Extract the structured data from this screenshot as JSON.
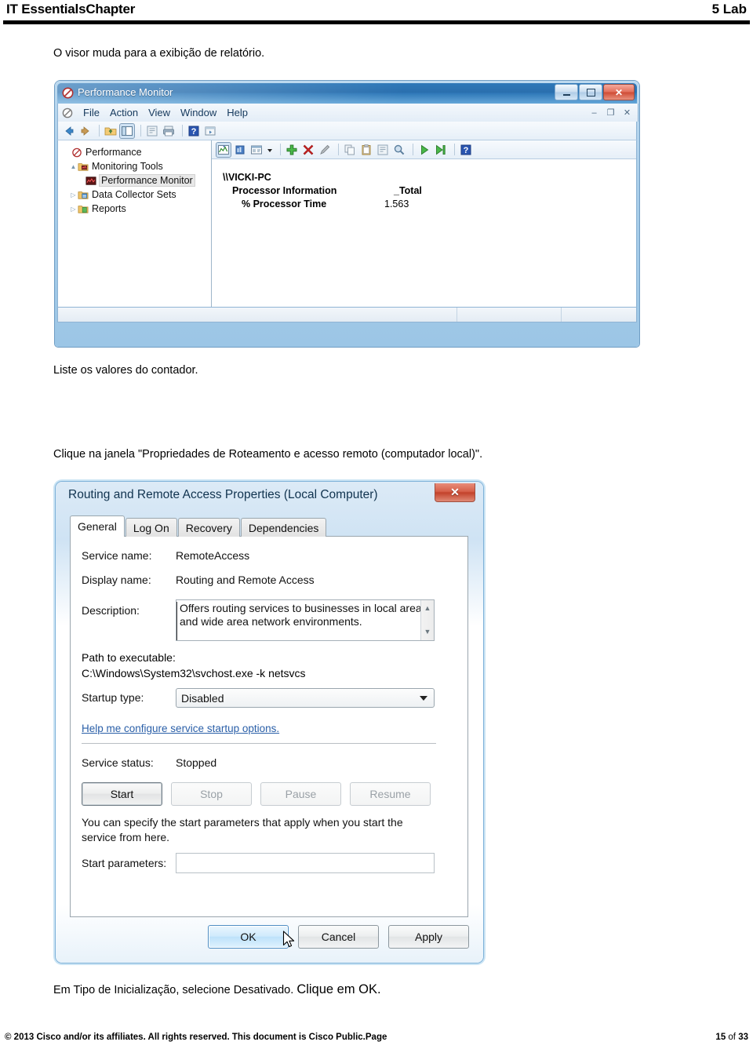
{
  "page_header": {
    "left_title": "IT EssentialsChapter",
    "right_title": "5 Lab"
  },
  "paragraphs": {
    "p1": "O visor muda para a exibição de relatório.",
    "p2": "Liste os valores do contador.",
    "p3": "Clique na janela \"Propriedades de Roteamento e acesso remoto (computador local)\".",
    "p4_a": "Em Tipo de Inicialização, selecione Desativado. ",
    "p4_b": "Clique em OK."
  },
  "page_footer": {
    "copyright": "© 2013 Cisco and/or its affiliates. All rights reserved. This document is Cisco Public.Page",
    "page_num": "15",
    "page_of": " of ",
    "page_total": "33"
  },
  "perfmon": {
    "title": "Performance Monitor",
    "icon": "performance-monitor-icon",
    "window_buttons": {
      "minimize": "minimize-icon",
      "maximize": "maximize-icon",
      "close": "✕"
    },
    "mdi_buttons": {
      "minimize": "–",
      "restore": "❐",
      "close": "✕"
    },
    "menu": [
      "File",
      "Action",
      "View",
      "Window",
      "Help"
    ],
    "toolbar_icons": [
      "back-arrow-icon",
      "forward-arrow-icon",
      "sep",
      "up-folder-icon",
      "show-hide-console-tree-icon",
      "sep",
      "properties-icon",
      "print-icon",
      "sep",
      "help-icon",
      "new-window-icon"
    ],
    "report_toolbar_icons": [
      "view-graph-icon",
      "view-histogram-icon",
      "view-report-icon",
      "view-dropdown-caret",
      "sep",
      "add-counter-icon",
      "delete-counter-icon",
      "highlight-icon",
      "sep",
      "copy-properties-icon",
      "paste-counter-list-icon",
      "properties-icon",
      "zoom-icon",
      "sep",
      "unfreeze-display-icon",
      "update-data-icon",
      "sep",
      "help-icon"
    ],
    "tree": [
      {
        "label": "Performance",
        "icon": "performance-root-icon",
        "depth": 0,
        "arrow": "",
        "selected": false
      },
      {
        "label": "Monitoring Tools",
        "icon": "monitoring-tools-folder-icon",
        "depth": 1,
        "arrow": "▲",
        "selected": false
      },
      {
        "label": "Performance Monitor",
        "icon": "performance-monitor-small-icon",
        "depth": 2,
        "arrow": "",
        "selected": true
      },
      {
        "label": "Data Collector Sets",
        "icon": "data-collector-sets-icon",
        "depth": 1,
        "arrow": "▷",
        "selected": false
      },
      {
        "label": "Reports",
        "icon": "reports-folder-icon",
        "depth": 1,
        "arrow": "▷",
        "selected": false
      }
    ],
    "report": {
      "computer": "\\\\VICKI-PC",
      "object": "Processor Information",
      "counter": "% Processor Time",
      "instance_header": "_Total",
      "value": "1.563"
    }
  },
  "rras_dialog": {
    "title": "Routing and Remote Access Properties (Local Computer)",
    "close_label": "✕",
    "tabs": [
      {
        "label": "General",
        "active": true
      },
      {
        "label": "Log On",
        "active": false
      },
      {
        "label": "Recovery",
        "active": false
      },
      {
        "label": "Dependencies",
        "active": false
      }
    ],
    "fields": {
      "service_name_label": "Service name:",
      "service_name_value": "RemoteAccess",
      "display_name_label": "Display name:",
      "display_name_value": "Routing and Remote Access",
      "description_label": "Description:",
      "description_value": "Offers routing services to businesses in local area and wide area network environments.",
      "path_label": "Path to executable:",
      "path_value": "C:\\Windows\\System32\\svchost.exe -k netsvcs",
      "startup_type_label": "Startup type:",
      "startup_type_value": "Disabled",
      "help_link": "Help me configure service startup options.",
      "service_status_label": "Service status:",
      "service_status_value": "Stopped",
      "hint": "You can specify the start parameters that apply when you start the service from here.",
      "start_parameters_label": "Start parameters:",
      "start_parameters_value": ""
    },
    "service_buttons": [
      {
        "label": "Start",
        "disabled": false
      },
      {
        "label": "Stop",
        "disabled": true
      },
      {
        "label": "Pause",
        "disabled": true
      },
      {
        "label": "Resume",
        "disabled": true
      }
    ],
    "footer_buttons": [
      {
        "label": "OK",
        "default": true
      },
      {
        "label": "Cancel",
        "default": false
      },
      {
        "label": "Apply",
        "default": false
      }
    ],
    "scroll": {
      "up": "▲",
      "down": "▼"
    }
  },
  "colors": {
    "header_rule": "#000000",
    "title_blue": "#2e78b8",
    "close_red": "#cf4b34",
    "link_blue": "#2a5fa8",
    "dialog_border": "#7fb2d9"
  }
}
